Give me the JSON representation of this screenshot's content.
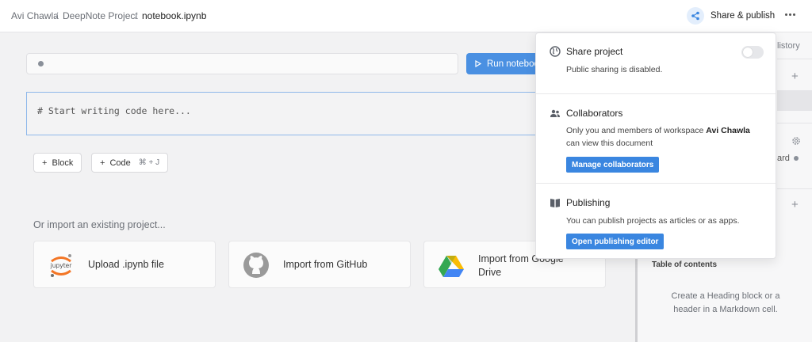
{
  "breadcrumb": {
    "workspace": "Avi Chawla",
    "project": "DeepNote Project",
    "file": "notebook.ipynb",
    "separator": "/"
  },
  "header": {
    "share_label": "Share & publish",
    "share_icon": "share-icon",
    "more_icon": "more-horizontal-icon"
  },
  "toolbar": {
    "run_label": "Run notebook"
  },
  "code_cell": {
    "text": "# Start writing code here..."
  },
  "add_blocks": {
    "block_label": "Block",
    "code_label": "Code",
    "code_shortcut": "⌘ + J"
  },
  "import": {
    "title": "Or import an existing project...",
    "options": [
      {
        "label": "Upload .ipynb file",
        "icon": "jupyter-icon"
      },
      {
        "label": "Import from GitHub",
        "icon": "github-icon"
      },
      {
        "label": "Import from Google Drive",
        "icon": "google-drive-icon"
      }
    ]
  },
  "right_panel": {
    "history_label": "listory",
    "partial_label": "ard",
    "toc_title": "Table of contents",
    "toc_empty": "Create a Heading block or a header in a Markdown cell."
  },
  "share_popup": {
    "share_project": {
      "title": "Share project",
      "description": "Public sharing is disabled.",
      "icon": "globe-icon",
      "enabled": false
    },
    "collaborators": {
      "title": "Collaborators",
      "description_prefix": "Only you and members of workspace",
      "workspace": "Avi Chawla",
      "description_suffix": "can view this document",
      "button": "Manage collaborators",
      "icon": "people-icon"
    },
    "publishing": {
      "title": "Publishing",
      "description": "You can publish projects as articles or as apps.",
      "button": "Open publishing editor",
      "icon": "book-icon"
    }
  },
  "colors": {
    "accent": "#3a86e0",
    "run_button": "#4a90e2",
    "cell_border": "#8fb8ea"
  }
}
